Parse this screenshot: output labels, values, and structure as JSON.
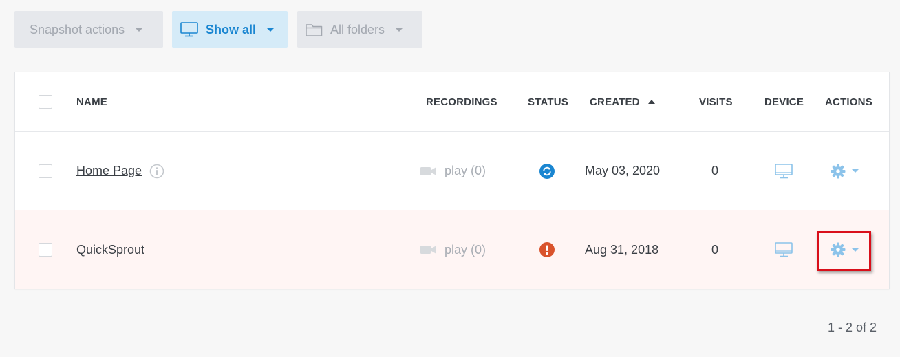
{
  "toolbar": {
    "snapshot_actions": "Snapshot actions",
    "show_all": "Show all",
    "all_folders": "All folders"
  },
  "table": {
    "headers": {
      "name": "NAME",
      "recordings": "RECORDINGS",
      "status": "STATUS",
      "created": "CREATED",
      "visits": "VISITS",
      "device": "DEVICE",
      "actions": "ACTIONS"
    },
    "sort": {
      "column": "created",
      "direction": "ascending"
    },
    "rows": [
      {
        "name": "Home Page",
        "has_info_icon": true,
        "recordings": "play (0)",
        "status_icon": "sync-icon",
        "created": "May 03, 2020",
        "visits": "0",
        "device_icon": "desktop-icon",
        "action_icon": "gear-icon"
      },
      {
        "name": "QuickSprout",
        "has_info_icon": false,
        "recordings": "play (0)",
        "status_icon": "alert-icon",
        "created": "Aug 31, 2018",
        "visits": "0",
        "device_icon": "desktop-icon",
        "action_icon": "gear-icon"
      }
    ]
  },
  "pagination": {
    "text": "1 - 2 of 2"
  },
  "colors": {
    "accent": "#1a86d1",
    "active_filter_bg": "#d5ebf8",
    "status_syncing": "#1a86d1",
    "status_error": "#d9532c",
    "error_row_bg": "#fff5f4",
    "highlight_border": "#d90f1a"
  }
}
